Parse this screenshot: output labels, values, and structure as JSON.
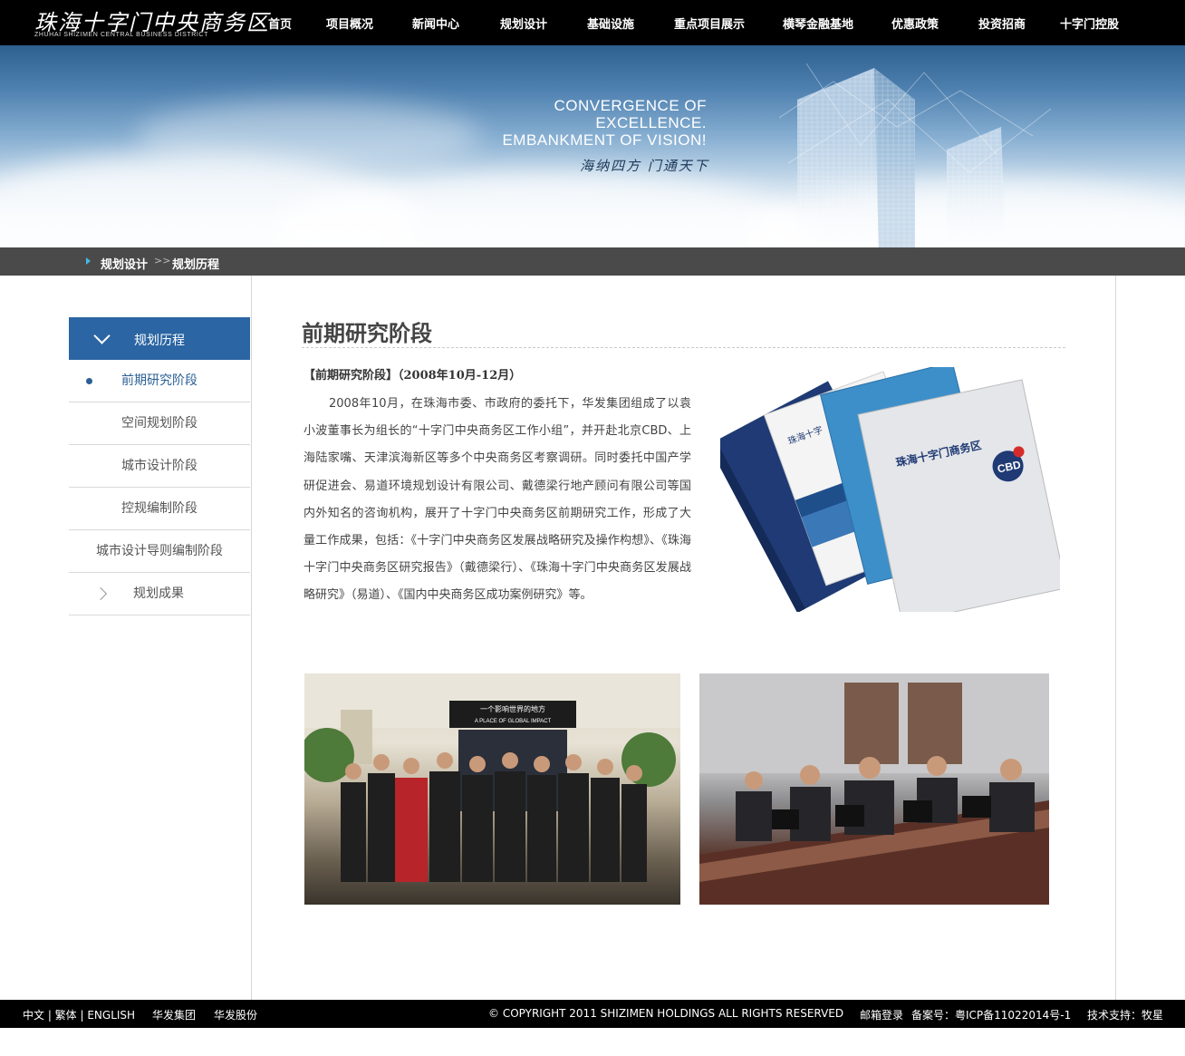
{
  "header": {
    "logo_cn": "珠海十字门中央商务区",
    "logo_en": "ZHUHAI SHIZIMEN CENTRAL BUSINESS DISTRICT",
    "nav": [
      "首页",
      "项目概况",
      "新闻中心",
      "规划设计",
      "基础设施",
      "重点项目展示",
      "横琴金融基地",
      "优惠政策",
      "投资招商",
      "十字门控股"
    ]
  },
  "banner": {
    "slogan_line1": "CONVERGENCE OF",
    "slogan_line2": "EXCELLENCE.",
    "slogan_line3": "EMBANKMENT OF VISION!",
    "slogan_cn": "海纳四方 门通天下"
  },
  "breadcrumb": {
    "section": "规划设计",
    "separator": ">>",
    "current": "规划历程"
  },
  "sidebar": {
    "heading": "规划历程",
    "items": [
      "前期研究阶段",
      "空间规划阶段",
      "城市设计阶段",
      "控规编制阶段",
      "城市设计导则编制阶段",
      "规划成果"
    ],
    "active_index": 0
  },
  "content": {
    "title": "前期研究阶段",
    "subtitle": "【前期研究阶段】（2008年10月-12月）",
    "body": "2008年10月，在珠海市委、市政府的委托下，华发集团组成了以袁小波董事长为组长的“十字门中央商务区工作小组”，并开赴北京CBD、上海陆家嘴、天津滨海新区等多个中央商务区考察调研。同时委托中国产学研促进会、易道环境规划设计有限公司、戴德梁行地产顾问有限公司等国内外知名的咨询机构，展开了十字门中央商务区前期研究工作，形成了大量工作成果，包括：《十字门中央商务区发展战略研究及操作构想》、《珠海十字门中央商务区研究报告》（戴德梁行）、《珠海十字门中央商务区发展战略研究》（易道）、《国内中央商务区成功案例研究》等。",
    "book_cover_title": "珠海十字门商务区",
    "book_badge": "CBD",
    "photo1_sign_cn": "一个影响世界的地方",
    "photo1_sign_en": "A PLACE OF GLOBAL IMPACT"
  },
  "footer": {
    "lang_links": "中文 | 繁体 | ENGLISH",
    "link1": "华发集团",
    "link2": "华发股份",
    "copyright": "© COPYRIGHT 2011 SHIZIMEN HOLDINGS ALL RIGHTS RESERVED",
    "mail_login": "邮箱登录",
    "icp": "备案号：粤ICP备11022014号-1",
    "support": "技术支持：牧星"
  },
  "colors": {
    "nav_bg": "#000000",
    "accent_blue": "#2b65a3",
    "breadcrumb_bg": "#4a4a4a",
    "breadcrumb_arrow": "#49b6e8"
  }
}
